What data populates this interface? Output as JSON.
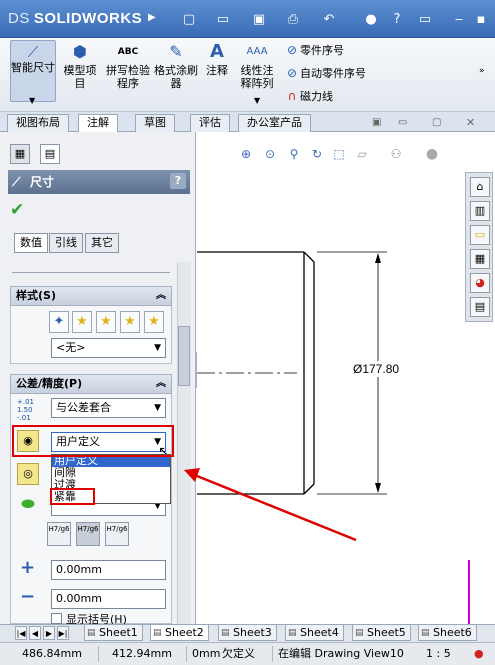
{
  "app": {
    "brand": "SOLIDWORKS",
    "brand_prefix": "DS"
  },
  "ribbon": {
    "smart_dimension": "智能尺寸",
    "model_items": "模型项目",
    "spell_checker": "拼写检验程序",
    "format_painter": "格式涂刷器",
    "note": "注释",
    "linear_note_pattern": "线性注释阵列",
    "balloon": "零件序号",
    "auto_balloon": "自动零件序号",
    "magnetic_line": "磁力线"
  },
  "tabs": [
    "视图布局",
    "注解",
    "草图",
    "评估",
    "办公室产品"
  ],
  "active_tab_index": 1,
  "property_manager": {
    "title": "尺寸",
    "help": "?",
    "subtabs": [
      "数值",
      "引线",
      "其它"
    ],
    "style_group": {
      "title": "样式(S)",
      "selected": "<无>"
    },
    "tolerance_group": {
      "title": "公差/精度(P)",
      "tolerance_type": "与公差套合",
      "fit_type": "用户定义",
      "fit_options": [
        "用户定义",
        "间隙",
        "过渡",
        "紧靠"
      ],
      "fit_buttons": [
        "H7/g6",
        "H7/g6",
        "H7/g6"
      ],
      "plus_value": "0.00mm",
      "minus_value": "0.00mm",
      "parentheses_label": "显示括号(H)"
    }
  },
  "drawing": {
    "dimension_label": "Ø177.80"
  },
  "sheets": [
    "Sheet1",
    "Sheet2",
    "Sheet3",
    "Sheet4",
    "Sheet5",
    "Sheet6"
  ],
  "active_sheet_index": 1,
  "status": {
    "x": "486.84mm",
    "y": "412.94mm",
    "z": "0mm",
    "state": "欠定义",
    "editing": "在编辑 Drawing View10",
    "scale": "1 : 5"
  },
  "colors": {
    "annotation_red": "#e00000",
    "selection_blue": "#3366cc",
    "title_blue": "#3a6cb8"
  }
}
